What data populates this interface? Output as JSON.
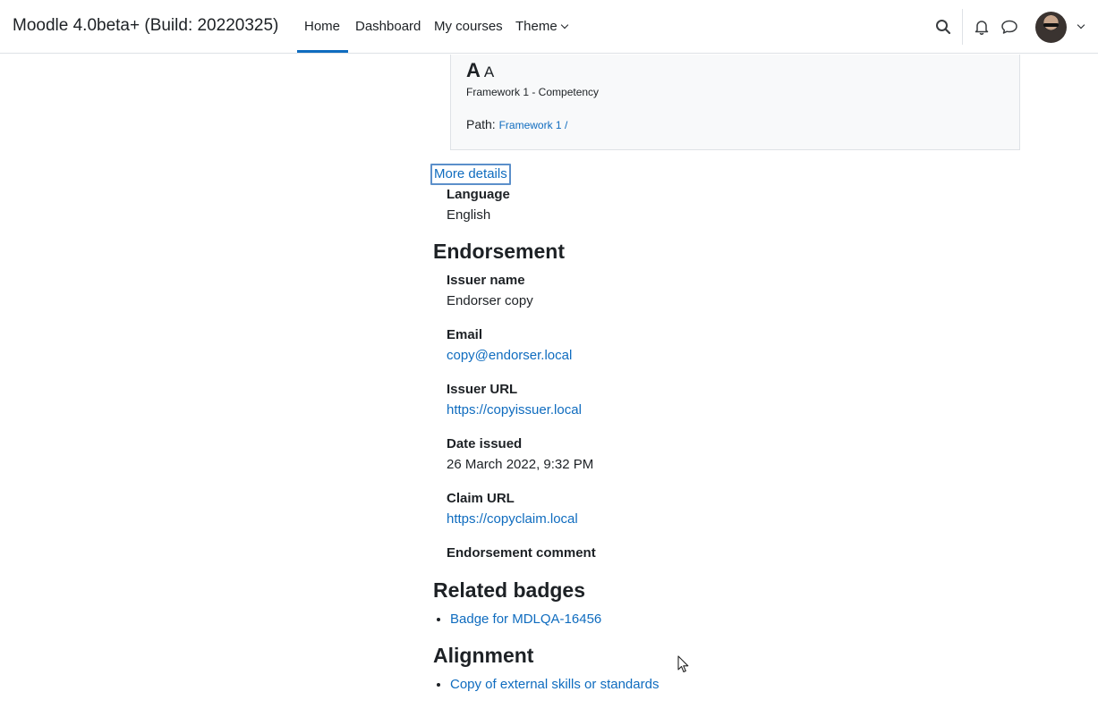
{
  "navbar": {
    "brand": "Moodle 4.0beta+ (Build: 20220325)",
    "items": [
      "Home",
      "Dashboard",
      "My courses",
      "Theme"
    ],
    "active": "Home"
  },
  "competency": {
    "short_big": "A",
    "short_small": "A",
    "subtitle": "Framework 1 - Competency",
    "path_label": "Path:",
    "path_link": "Framework 1",
    "path_sep": " /"
  },
  "more_details": "More details",
  "details": {
    "language_label": "Language",
    "language_value": "English"
  },
  "endorsement": {
    "heading": "Endorsement",
    "issuer_name_label": "Issuer name",
    "issuer_name_value": "Endorser copy",
    "email_label": "Email",
    "email_value": "copy@endorser.local",
    "issuer_url_label": "Issuer URL",
    "issuer_url_value": "https://copyissuer.local",
    "date_label": "Date issued",
    "date_value": "26 March 2022, 9:32 PM",
    "claim_label": "Claim URL",
    "claim_value": "https://copyclaim.local",
    "comment_label": "Endorsement comment"
  },
  "related": {
    "heading": "Related badges",
    "items": [
      "Badge for MDLQA-16456"
    ]
  },
  "alignment": {
    "heading": "Alignment",
    "items": [
      "Copy of external skills or standards"
    ]
  },
  "colors": {
    "link": "#0f6cbf",
    "text": "#1d2125",
    "card_bg": "#f8f9fa",
    "focus": "#5b8fca"
  }
}
